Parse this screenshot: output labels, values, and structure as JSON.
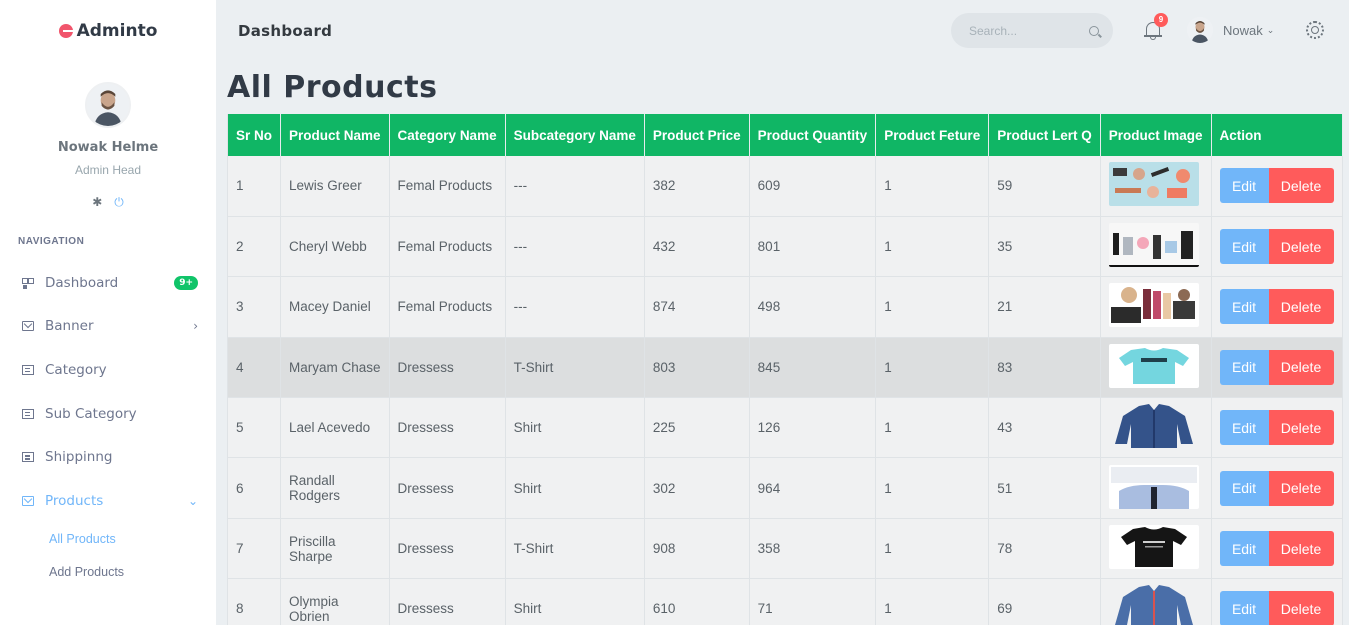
{
  "brand": {
    "name": "Adminto"
  },
  "sidebar": {
    "user": {
      "name": "Nowak Helme",
      "role": "Admin Head"
    },
    "nav_title": "Navigation",
    "items": [
      {
        "label": "Dashboard",
        "badge": "9+",
        "icon": "dashboard-icon"
      },
      {
        "label": "Banner",
        "chevron": "›",
        "icon": "mail-icon"
      },
      {
        "label": "Category",
        "icon": "chat-icon"
      },
      {
        "label": "Sub Category",
        "icon": "chat-icon"
      },
      {
        "label": "Shippinng",
        "icon": "chat-icon"
      },
      {
        "label": "Products",
        "chevron": "⌄",
        "icon": "mail-icon",
        "active": true
      }
    ],
    "sub_items": [
      {
        "label": "All Products",
        "active": true
      },
      {
        "label": "Add Products"
      }
    ]
  },
  "topbar": {
    "title": "Dashboard",
    "search_placeholder": "Search...",
    "notification_count": "9",
    "profile_name": "Nowak"
  },
  "main": {
    "heading": "All Products",
    "columns": [
      "Sr No",
      "Product Name",
      "Category Name",
      "Subcategory Name",
      "Product Price",
      "Product Quantity",
      "Product Feture",
      "Product Lert Q",
      "Product Image",
      "Action"
    ],
    "edit_label": "Edit",
    "delete_label": "Delete",
    "rows": [
      {
        "sr": "1",
        "name": "Lewis Greer",
        "category": "Femal Products",
        "subcategory": "---",
        "price": "382",
        "quantity": "609",
        "feature": "1",
        "lert": "59",
        "image": "makeup-products"
      },
      {
        "sr": "2",
        "name": "Cheryl Webb",
        "category": "Femal Products",
        "subcategory": "---",
        "price": "432",
        "quantity": "801",
        "feature": "1",
        "lert": "35",
        "image": "cosmetics"
      },
      {
        "sr": "3",
        "name": "Macey Daniel",
        "category": "Femal Products",
        "subcategory": "---",
        "price": "874",
        "quantity": "498",
        "feature": "1",
        "lert": "21",
        "image": "makeup-kit"
      },
      {
        "sr": "4",
        "name": "Maryam Chase",
        "category": "Dressess",
        "subcategory": "T-Shirt",
        "price": "803",
        "quantity": "845",
        "feature": "1",
        "lert": "83",
        "image": "cyan-tshirt"
      },
      {
        "sr": "5",
        "name": "Lael Acevedo",
        "category": "Dressess",
        "subcategory": "Shirt",
        "price": "225",
        "quantity": "126",
        "feature": "1",
        "lert": "43",
        "image": "blue-shirt"
      },
      {
        "sr": "6",
        "name": "Randall Rodgers",
        "category": "Dressess",
        "subcategory": "Shirt",
        "price": "302",
        "quantity": "964",
        "feature": "1",
        "lert": "51",
        "image": "light-shirt"
      },
      {
        "sr": "7",
        "name": "Priscilla Sharpe",
        "category": "Dressess",
        "subcategory": "T-Shirt",
        "price": "908",
        "quantity": "358",
        "feature": "1",
        "lert": "78",
        "image": "black-tshirt"
      },
      {
        "sr": "8",
        "name": "Olympia Obrien",
        "category": "Dressess",
        "subcategory": "Shirt",
        "price": "610",
        "quantity": "71",
        "feature": "1",
        "lert": "69",
        "image": "denim-shirt"
      }
    ]
  },
  "colors": {
    "accent": "#71b6f9",
    "header_green": "#10b665",
    "danger": "#ff5b5b",
    "badge_green": "#10c469"
  }
}
